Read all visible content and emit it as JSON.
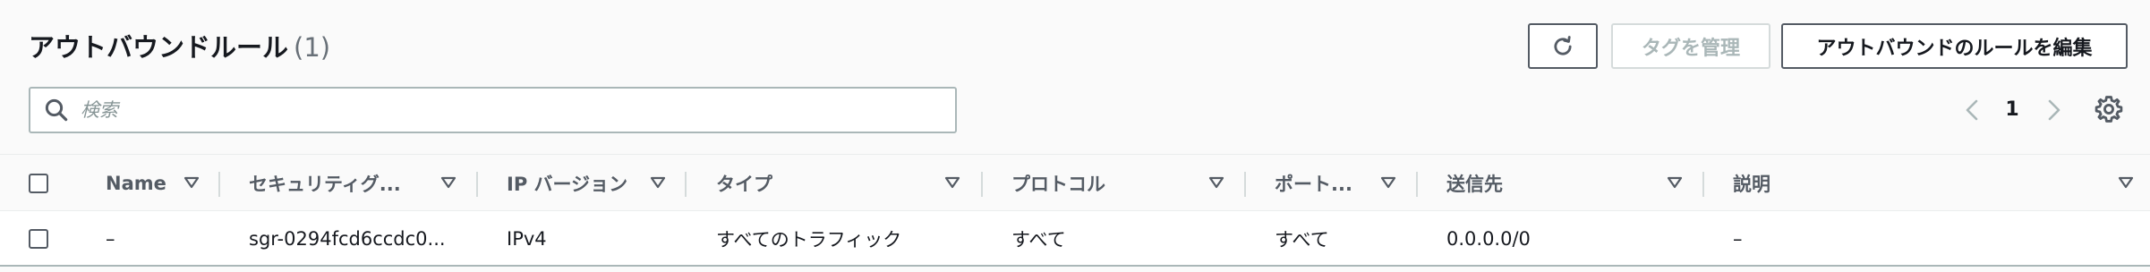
{
  "header": {
    "title": "アウトバウンドルール",
    "count": "(1)"
  },
  "buttons": {
    "refresh_icon": "refresh-icon",
    "manage_tags": "タグを管理",
    "edit_rules": "アウトバウンドのルールを編集"
  },
  "search": {
    "placeholder": "検索",
    "value": "",
    "icon": "search-icon"
  },
  "pagination": {
    "current_page": "1",
    "prev_icon": "chevron-left-icon",
    "next_icon": "chevron-right-icon",
    "settings_icon": "gear-icon"
  },
  "table": {
    "columns": [
      "Name",
      "セキュリティグ...",
      "IP バージョン",
      "タイプ",
      "プロトコル",
      "ポート...",
      "送信先",
      "説明"
    ],
    "rows": [
      {
        "name": "–",
        "security_group_rule_id": "sgr-0294fcd6ccdc0...",
        "ip_version": "IPv4",
        "type": "すべてのトラフィック",
        "protocol": "すべて",
        "port_range": "すべて",
        "destination": "0.0.0.0/0",
        "description": "–"
      }
    ]
  },
  "colors": {
    "background": "#fafafa",
    "text": "#16191f",
    "header_text": "#545b64",
    "muted": "#687078",
    "disabled": "#aab7b8",
    "border": "#d5dbdb"
  }
}
